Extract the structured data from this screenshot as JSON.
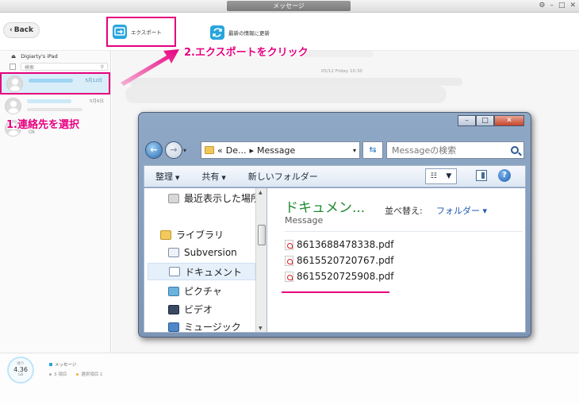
{
  "window": {
    "title": "メッセージ"
  },
  "toolbar": {
    "back_label": "Back",
    "export_label": "エクスポート",
    "refresh_label": "最新の情報に更新",
    "accent": "#29a5dc"
  },
  "sidebar": {
    "device_name": "Digiarty's iPad",
    "search_placeholder": "検索",
    "contacts": [
      {
        "date": "5月12日",
        "selected": true
      },
      {
        "date": "5月6日",
        "selected": false
      },
      {
        "snippet": "Ok",
        "selected": false
      }
    ]
  },
  "conversation": {
    "date_header": "05/12 Friday 10:30"
  },
  "annotations": {
    "step1": "1.連絡先を選択",
    "step2": "2.エクスポートをクリック",
    "color": "#e5007f"
  },
  "explorer": {
    "path": [
      "«",
      "De...",
      "▸",
      "Message"
    ],
    "search_placeholder": "Messageの検索",
    "commands": {
      "organize": "整理",
      "share": "共有",
      "new_folder": "新しいフォルダー"
    },
    "nav_items": [
      {
        "label": "最近表示した場所",
        "icon": "recent-places-icon"
      },
      {
        "label": "ライブラリ",
        "icon": "library-icon"
      },
      {
        "label": "Subversion",
        "icon": "document-icon"
      },
      {
        "label": "ドキュメント",
        "icon": "document-icon",
        "selected": true
      },
      {
        "label": "ピクチャ",
        "icon": "picture-icon"
      },
      {
        "label": "ビデオ",
        "icon": "video-icon"
      },
      {
        "label": "ミュージック",
        "icon": "music-icon"
      }
    ],
    "content": {
      "title": "ドキュメン...",
      "subtitle": "Message",
      "sort_label": "並べ替え:",
      "sort_value": "フォルダー ▾",
      "files": [
        "8613688478338.pdf",
        "8615520720767.pdf",
        "8615520725908.pdf"
      ]
    }
  },
  "statusbar": {
    "storage_label": "残り",
    "storage_value": "4.36",
    "storage_unit": "GB",
    "legend_label": "メッセージ",
    "item_count": "3 項目",
    "selected_count": "選択項目 1"
  }
}
